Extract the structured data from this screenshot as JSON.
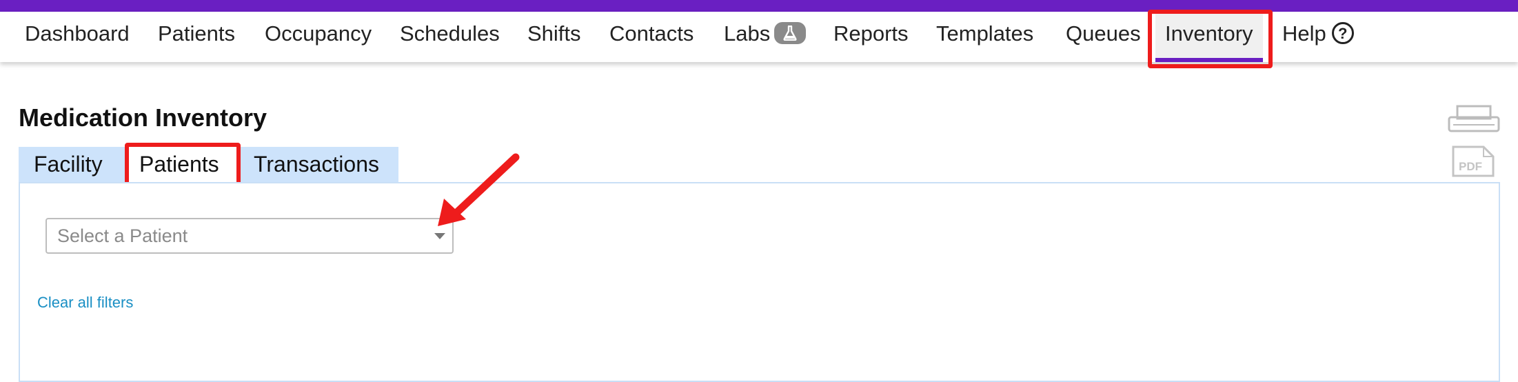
{
  "nav": {
    "items": [
      {
        "id": "dashboard",
        "label": "Dashboard"
      },
      {
        "id": "patients",
        "label": "Patients"
      },
      {
        "id": "occupancy",
        "label": "Occupancy"
      },
      {
        "id": "schedules",
        "label": "Schedules"
      },
      {
        "id": "shifts",
        "label": "Shifts"
      },
      {
        "id": "contacts",
        "label": "Contacts"
      },
      {
        "id": "labs",
        "label": "Labs",
        "icon": "flask-icon"
      },
      {
        "id": "reports",
        "label": "Reports"
      },
      {
        "id": "templates",
        "label": "Templates"
      },
      {
        "id": "queues",
        "label": "Queues"
      },
      {
        "id": "inventory",
        "label": "Inventory",
        "active": true
      },
      {
        "id": "help",
        "label": "Help",
        "icon": "help-circle-icon"
      }
    ],
    "help_glyph": "?"
  },
  "page": {
    "title": "Medication Inventory",
    "tabs": [
      {
        "label": "Facility"
      },
      {
        "label": "Patients",
        "active": true
      },
      {
        "label": "Transactions"
      }
    ],
    "patient_select": {
      "placeholder": "Select a Patient"
    },
    "clear_filters": "Clear all filters",
    "toolbar_icons": [
      "printer-icon",
      "pdf-icon"
    ],
    "pdf_icon_text": "PDF"
  },
  "colors": {
    "brand": "#6a1fc2",
    "highlight": "#ee1c1c",
    "tab_bg": "#cde3fb",
    "link": "#1a8fc4"
  }
}
